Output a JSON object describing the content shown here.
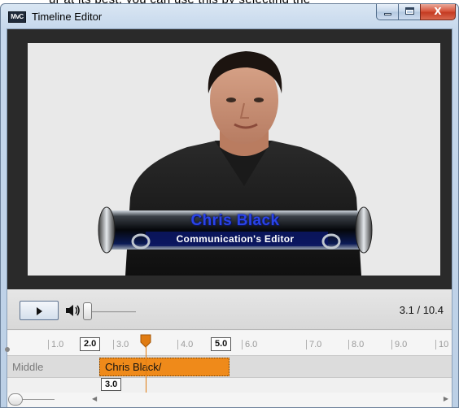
{
  "window": {
    "title": "Timeline Editor",
    "app_icon_text": "MvC",
    "close_glyph": "X"
  },
  "video": {
    "lower_third": {
      "name": "Chris Black",
      "role": "Communication's Editor"
    }
  },
  "transport": {
    "time_readout": "3.1 / 10.4",
    "volume_level": 0
  },
  "ruler": {
    "ticks": [
      "1.0",
      "2.0",
      "3.0",
      "4.0",
      "5.0",
      "6.0",
      "7.0",
      "8.0",
      "9.0",
      "10"
    ],
    "range_start_label": "2.0",
    "range_end_label": "5.0"
  },
  "timeline": {
    "track_name": "Middle",
    "clip_label": "Chris Black/",
    "clip_time_label": "3.0"
  },
  "colors": {
    "clip": "#ef8a1a",
    "playhead": "#e07b11",
    "lower_third_name": "#2a43e8"
  }
}
